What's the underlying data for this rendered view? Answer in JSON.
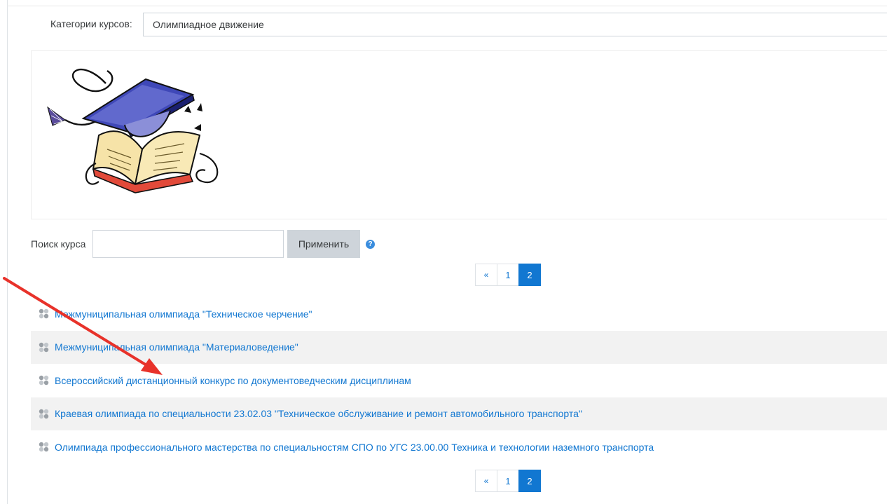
{
  "filter": {
    "label": "Категории курсов:",
    "selected": "Олимпиадное движение"
  },
  "search": {
    "label": "Поиск курса",
    "value": "",
    "apply_label": "Применить",
    "help_icon": "?"
  },
  "pagination": {
    "prev": "«",
    "pages": [
      "1",
      "2"
    ],
    "current": "2"
  },
  "courses": [
    {
      "title": "Межмуниципальная олимпиада \"Техническое черчение\""
    },
    {
      "title": "Межмуниципальная олимпиада \"Материаловедение\""
    },
    {
      "title": "Всероссийский дистанционный конкурс по документоведческим дисциплинам"
    },
    {
      "title": "Краевая олимпиада по специальности 23.02.03 \"Техническое обслуживание и ремонт автомобильного транспорта\""
    },
    {
      "title": "Олимпиада профессионального мастерства по специальностям СПО по УГС 23.00.00 Техника и технологии наземного транспорта"
    }
  ],
  "colors": {
    "link": "#1177d1",
    "active_page": "#1177d1",
    "annotation_arrow": "#e8322a",
    "row_stripe": "#f2f2f2"
  },
  "icons": {
    "course": "course-cluster-icon",
    "help": "question-circle-icon",
    "annotation": "red-arrow-annotation"
  }
}
